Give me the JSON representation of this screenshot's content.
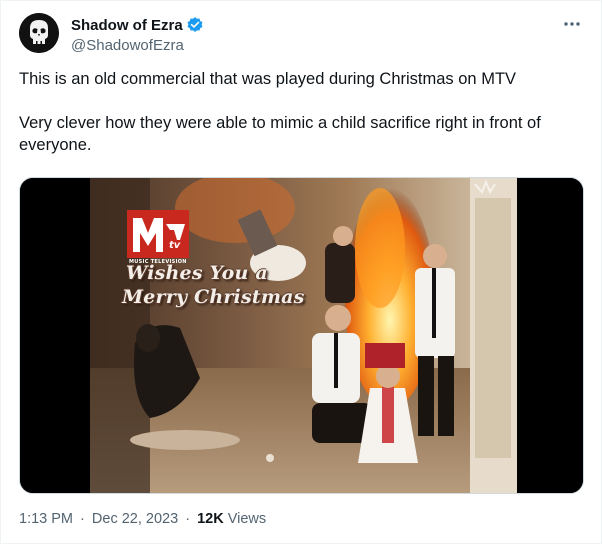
{
  "author": {
    "display_name": "Shadow of Ezra",
    "handle": "@ShadowofEzra",
    "verified": true,
    "avatar_icon": "punisher-skull-icon"
  },
  "tweet": {
    "paragraph_1": "This is an old commercial that was played during Christmas on MTV",
    "paragraph_2": "Very clever how they were able to mimic a child sacrifice right in front of everyone."
  },
  "media": {
    "logo_text": "MTV",
    "logo_subtext": "MUSIC TELEVISION",
    "overlay_line_1": "Wishes You a",
    "overlay_line_2": "Merry Christmas"
  },
  "meta": {
    "time": "1:13 PM",
    "date": "Dec 22, 2023",
    "views_count": "12K",
    "views_label": "Views",
    "separator": "·"
  },
  "colors": {
    "verified_blue": "#1d9bf0",
    "secondary_text": "#536471",
    "primary_text": "#0f1419"
  },
  "icons": {
    "verified": "verified-badge-icon",
    "more": "more-horizontal-icon"
  }
}
